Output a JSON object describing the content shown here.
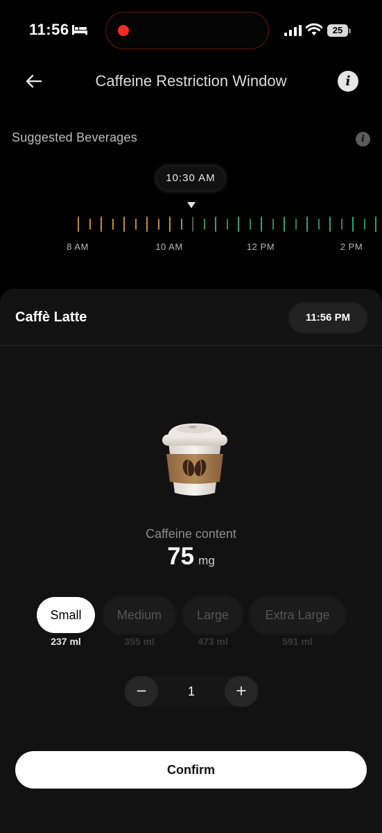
{
  "status_bar": {
    "time": "11:56",
    "battery_level": "25",
    "icons": [
      "bed-icon",
      "recording-dot",
      "signal-icon",
      "wifi-icon",
      "battery-icon"
    ]
  },
  "header": {
    "title": "Caffeine Restriction Window",
    "back_icon": "arrow-left-icon",
    "info_icon": "info-icon",
    "info_glyph": "i"
  },
  "suggested": {
    "label": "Suggested Beverages",
    "info_glyph": "i"
  },
  "timeline": {
    "current_time": "10:30 AM",
    "labels": [
      "8 AM",
      "10 AM",
      "12 PM",
      "2 PM"
    ],
    "colors": {
      "restricted": "#c98a3e",
      "allowed": "#2fa37c"
    }
  },
  "card": {
    "beverage_name": "Caffè Latte",
    "time": "11:56 PM",
    "image_icon": "coffee-cup-icon",
    "caffeine_label": "Caffeine content",
    "caffeine_value": "75",
    "caffeine_unit": "mg",
    "sizes": [
      {
        "label": "Small",
        "ml": "237 ml",
        "selected": true
      },
      {
        "label": "Medium",
        "ml": "355 ml",
        "selected": false
      },
      {
        "label": "Large",
        "ml": "473 ml",
        "selected": false
      },
      {
        "label": "Extra Large",
        "ml": "591 ml",
        "selected": false
      }
    ],
    "quantity": {
      "value": "1",
      "minus": "−",
      "plus": "+"
    },
    "confirm_label": "Confirm"
  }
}
